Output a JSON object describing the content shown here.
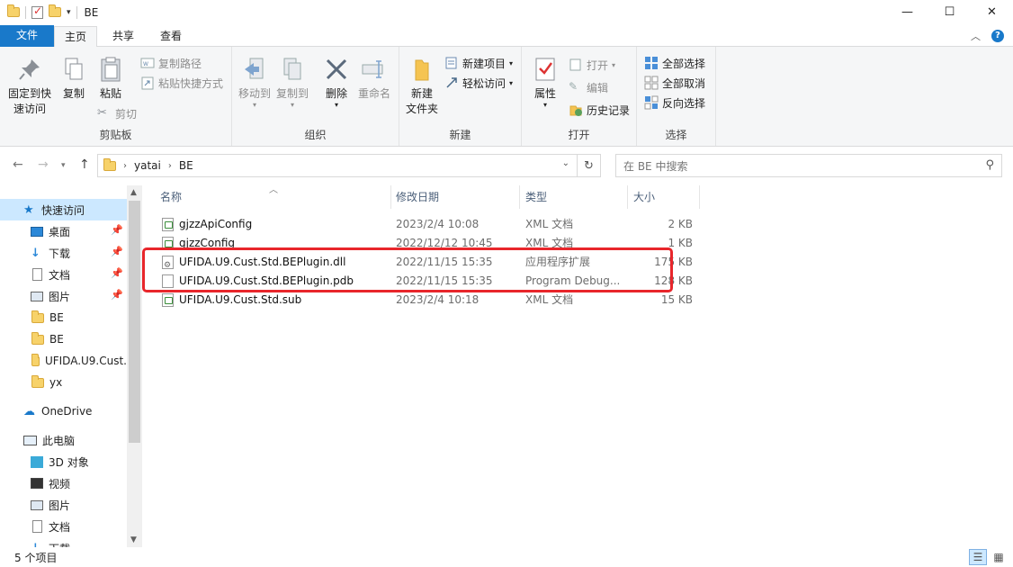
{
  "window": {
    "title": "BE",
    "minimize": "—",
    "maximize": "☐",
    "close": "✕"
  },
  "tabs": [
    {
      "label": "文件"
    },
    {
      "label": "主页"
    },
    {
      "label": "共享"
    },
    {
      "label": "查看"
    }
  ],
  "ribbon": {
    "clipboard": {
      "label": "剪贴板",
      "pin": "固定到快速访问",
      "pin_l1": "固定到快",
      "pin_l2": "速访问",
      "copy": "复制",
      "paste": "粘贴",
      "copy_path": "复制路径",
      "paste_shortcut": "粘贴快捷方式",
      "cut": "剪切"
    },
    "organize": {
      "label": "组织",
      "move_to": "移动到",
      "copy_to": "复制到",
      "delete": "删除",
      "rename": "重命名"
    },
    "new": {
      "label": "新建",
      "new_folder_l1": "新建",
      "new_folder_l2": "文件夹",
      "new_item": "新建项目",
      "easy_access": "轻松访问"
    },
    "open": {
      "label": "打开",
      "properties": "属性",
      "open": "打开",
      "edit": "编辑",
      "history": "历史记录"
    },
    "select": {
      "label": "选择",
      "select_all": "全部选择",
      "select_none": "全部取消",
      "invert": "反向选择"
    }
  },
  "address": {
    "crumbs": [
      "yatai",
      "BE"
    ],
    "search_placeholder": "在 BE 中搜索"
  },
  "nav": {
    "quick_access": "快速访问",
    "items": [
      {
        "label": "桌面",
        "pinned": true
      },
      {
        "label": "下载",
        "pinned": true
      },
      {
        "label": "文档",
        "pinned": true
      },
      {
        "label": "图片",
        "pinned": true
      },
      {
        "label": "BE"
      },
      {
        "label": "BE"
      },
      {
        "label": "UFIDA.U9.Cust."
      },
      {
        "label": "yx"
      }
    ],
    "onedrive": "OneDrive",
    "this_pc": "此电脑",
    "pc_items": [
      {
        "label": "3D 对象"
      },
      {
        "label": "视频"
      },
      {
        "label": "图片"
      },
      {
        "label": "文档"
      },
      {
        "label": "下载"
      }
    ]
  },
  "columns": {
    "name": "名称",
    "date": "修改日期",
    "type": "类型",
    "size": "大小"
  },
  "files": [
    {
      "name": "gjzzApiConfig",
      "date": "2023/2/4 10:08",
      "type": "XML 文档",
      "size": "2 KB",
      "icon": "xml-file-icon"
    },
    {
      "name": "gjzzConfig",
      "date": "2022/12/12 10:45",
      "type": "XML 文档",
      "size": "1 KB",
      "icon": "xml-file-icon"
    },
    {
      "name": "UFIDA.U9.Cust.Std.BEPlugin.dll",
      "date": "2022/11/15 15:35",
      "type": "应用程序扩展",
      "size": "175 KB",
      "icon": "dll-file-icon"
    },
    {
      "name": "UFIDA.U9.Cust.Std.BEPlugin.pdb",
      "date": "2022/11/15 15:35",
      "type": "Program Debug...",
      "size": "128 KB",
      "icon": "pdb-file-icon"
    },
    {
      "name": "UFIDA.U9.Cust.Std.sub",
      "date": "2023/2/4 10:18",
      "type": "XML 文档",
      "size": "15 KB",
      "icon": "xml-file-icon"
    }
  ],
  "status": {
    "count": "5 个项目"
  },
  "colors": {
    "accent": "#1979ca",
    "highlight_box": "#e8262b",
    "selection": "#cce8ff"
  }
}
